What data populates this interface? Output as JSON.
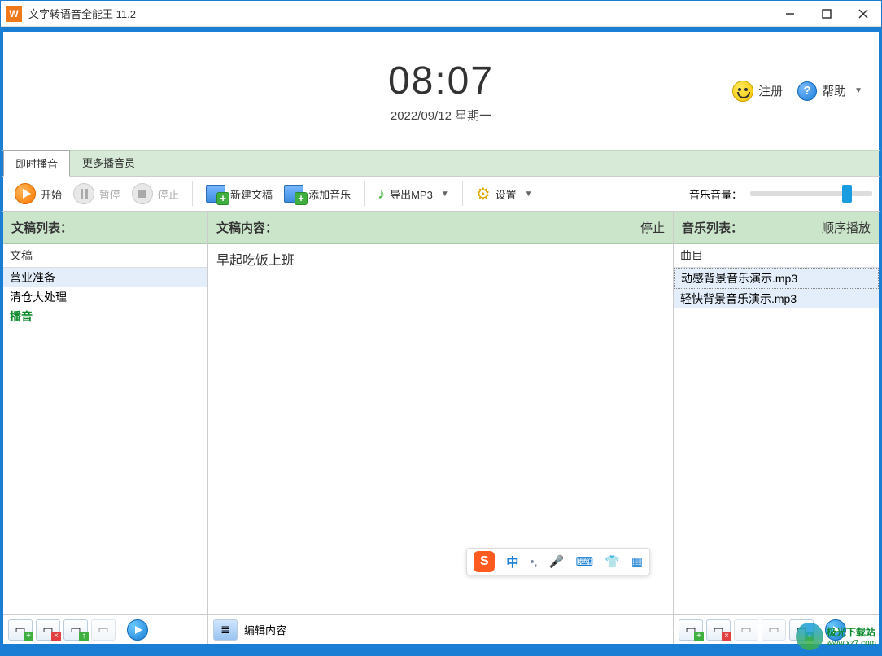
{
  "window": {
    "title": "文字转语音全能王 11.2"
  },
  "clock": {
    "time": "08:07",
    "date": "2022/09/12 星期一"
  },
  "header": {
    "register": "注册",
    "help": "帮助"
  },
  "tabs": {
    "t1": "即时播音",
    "t2": "更多播音员"
  },
  "toolbar": {
    "start": "开始",
    "pause": "暂停",
    "stop": "停止",
    "newdoc": "新建文稿",
    "addmusic": "添加音乐",
    "export": "导出MP3",
    "settings": "设置",
    "volume_label": "音乐音量："
  },
  "panels": {
    "doclist": {
      "title": "文稿列表：",
      "colhead": "文稿",
      "items": [
        "营业准备",
        "清仓大处理",
        "播音"
      ],
      "active_index": 2
    },
    "content": {
      "title": "文稿内容：",
      "status": "停止",
      "text": "早起吃饭上班",
      "edit_label": "编辑内容"
    },
    "music": {
      "title": "音乐列表：",
      "mode": "顺序播放",
      "colhead": "曲目",
      "items": [
        "动感背景音乐演示.mp3",
        "轻快背景音乐演示.mp3"
      ],
      "selected_index": 0
    }
  },
  "ime": {
    "lang": "中"
  },
  "watermark": {
    "text": "极光下载站",
    "url": "www.xz7.com"
  }
}
